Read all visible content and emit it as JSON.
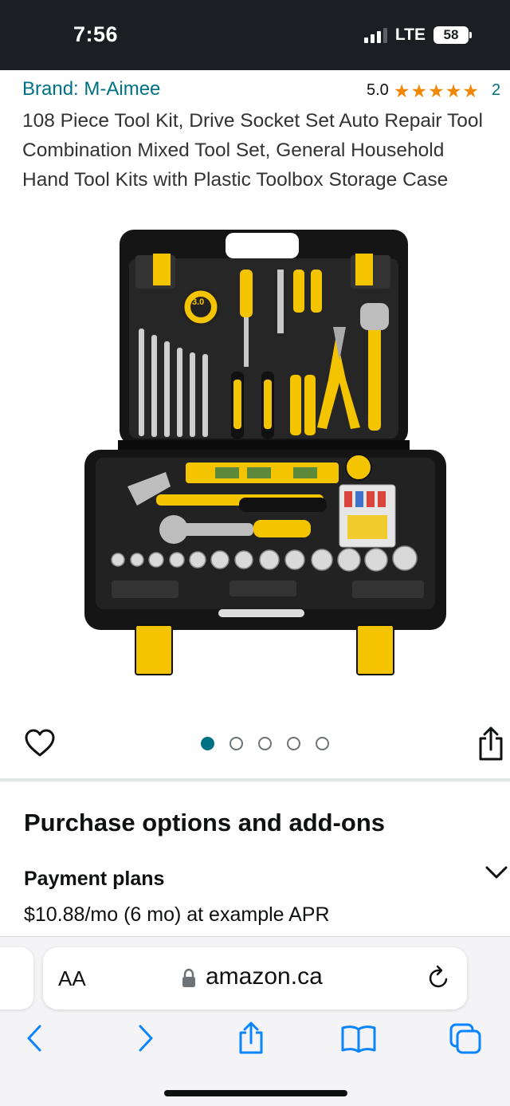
{
  "status_bar": {
    "time": "7:56",
    "network": "LTE",
    "battery": "58"
  },
  "product": {
    "brand": "Brand: M-Aimee",
    "rating": "5.0",
    "rating_count": "2",
    "title": "108 Piece Tool Kit, Drive Socket Set Auto Repair Tool Combination Mixed Tool Set, General Household Hand Tool Kits with Plastic Toolbox Storage Case",
    "image_label_tape": "3.0",
    "image_count": 5,
    "active_image_index": 0
  },
  "section": {
    "heading": "Purchase options and add-ons",
    "payment_label": "Payment plans",
    "payment_detail": "$10.88/mo (6 mo) at example APR"
  },
  "browser": {
    "reader_label": "AA",
    "url": "amazon.ca"
  },
  "colors": {
    "link": "#007185",
    "star": "#f08804",
    "tool_yellow": "#f5c400",
    "status_bar": "#1b1f24",
    "ios_blue": "#0a84ff"
  },
  "icons": [
    "heart-icon",
    "share-icon",
    "chevron-down-icon",
    "lock-icon",
    "reload-icon",
    "back-icon",
    "forward-icon",
    "share-toolbar-icon",
    "bookmarks-icon",
    "tabs-icon"
  ]
}
